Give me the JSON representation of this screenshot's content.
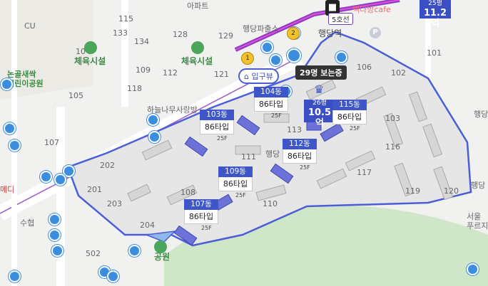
{
  "map": {
    "area_labels": [
      {
        "name": "label-apartment-top",
        "text": "아파트"
      },
      {
        "name": "label-cu",
        "text": "CU"
      },
      {
        "name": "label-sports-left",
        "text": "체육시설"
      },
      {
        "name": "label-sports-right",
        "text": "체육시설"
      },
      {
        "name": "label-community-center",
        "text": "행당파출소"
      },
      {
        "name": "label-station",
        "text": "행당역"
      },
      {
        "name": "label-park-nongol",
        "text": "논골새싹\n어린이공원"
      },
      {
        "name": "label-kindergarten",
        "text": "하늘나무사랑방"
      },
      {
        "name": "label-park",
        "text": "공원"
      },
      {
        "name": "label-suwon",
        "text": "수협"
      },
      {
        "name": "label-haengdang-right",
        "text": "행당"
      },
      {
        "name": "label-haengdang-right2",
        "text": "행당"
      },
      {
        "name": "label-seoul-right",
        "text": "서울\n푸르지"
      },
      {
        "name": "label-haengdang-inner",
        "text": "행당"
      },
      {
        "name": "label-medical",
        "text": "메디"
      }
    ],
    "building_numbers": [
      "101",
      "102",
      "103",
      "104",
      "105",
      "106",
      "107",
      "108",
      "109",
      "110",
      "111",
      "112",
      "113",
      "115",
      "116",
      "117",
      "118",
      "119",
      "120",
      "121",
      "129",
      "201",
      "202",
      "203",
      "204",
      "502",
      "133",
      "134",
      "128"
    ],
    "entry_label": "입구뷰",
    "viewers_label": "29명 보는중",
    "line5_label": "5호선",
    "cafe_label": "빽다방cafe",
    "subway_numbers": [
      "1",
      "2"
    ],
    "parking_label": "P",
    "buildings": [
      {
        "name": "building-tag-104",
        "dong": "104동",
        "type": "86타입",
        "floor": "25F"
      },
      {
        "name": "building-tag-103",
        "dong": "103동",
        "type": "86타입",
        "floor": "25F"
      },
      {
        "name": "building-tag-115",
        "dong": "115동",
        "type": "86타입",
        "floor": "25F"
      },
      {
        "name": "building-tag-112",
        "dong": "112동",
        "type": "86타입",
        "floor": "25F"
      },
      {
        "name": "building-tag-109",
        "dong": "109동",
        "type": "86타입",
        "floor": "25F"
      },
      {
        "name": "building-tag-107",
        "dong": "107동",
        "type": "86타입",
        "floor": "25F"
      }
    ],
    "prices": [
      {
        "name": "price-main",
        "pyeong": "26평",
        "value": "10.5억"
      },
      {
        "name": "price-topright",
        "pyeong": "25평",
        "value": "11.2억"
      }
    ]
  },
  "colors": {
    "accent": "#3f56c9",
    "boundary": "#4a5fd6",
    "subway": "#6c3ec1",
    "bus": "#3b8de0",
    "park": "#cfe6c9"
  }
}
